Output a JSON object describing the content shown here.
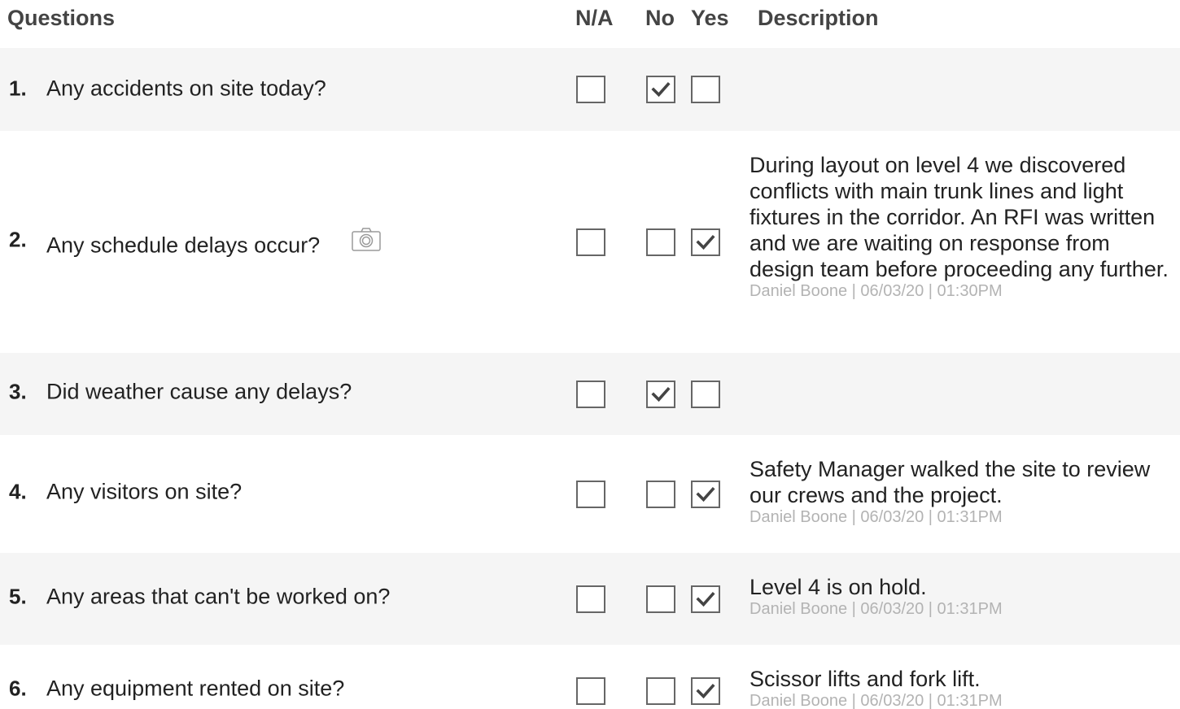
{
  "header": {
    "questions": "Questions",
    "na": "N/A",
    "no": "No",
    "yes": "Yes",
    "description": "Description"
  },
  "questions": [
    {
      "number": "1.",
      "text": "Any accidents on site today?",
      "answer": "no",
      "description": "",
      "meta": ""
    },
    {
      "number": "2.",
      "text": "Any schedule delays occur?",
      "has_photo": true,
      "icon": "camera-icon",
      "answer": "yes",
      "description": "During layout on level 4 we discovered conflicts with main trunk lines and light fixtures in the corridor. An RFI was written and we are waiting on response from design team before proceeding any further.",
      "meta": "Daniel Boone | 06/03/20 | 01:30PM"
    },
    {
      "number": "3.",
      "text": "Did weather cause any delays?",
      "answer": "no",
      "description": "",
      "meta": ""
    },
    {
      "number": "4.",
      "text": "Any visitors on site?",
      "answer": "yes",
      "description": "Safety Manager walked the site to review our crews and the project.",
      "meta": "Daniel Boone | 06/03/20 | 01:31PM"
    },
    {
      "number": "5.",
      "text": "Any areas that can't be worked on?",
      "answer": "yes",
      "description": "Level 4 is on hold.",
      "meta": "Daniel Boone | 06/03/20 | 01:31PM"
    },
    {
      "number": "6.",
      "text": "Any equipment rented on site?",
      "answer": "yes",
      "description": "Scissor lifts and fork lift.",
      "meta": "Daniel Boone | 06/03/20 | 01:31PM"
    }
  ],
  "colors": {
    "row_shade": "#f5f5f5",
    "meta_text": "#b3b3b3",
    "checkbox_border": "#666666"
  }
}
